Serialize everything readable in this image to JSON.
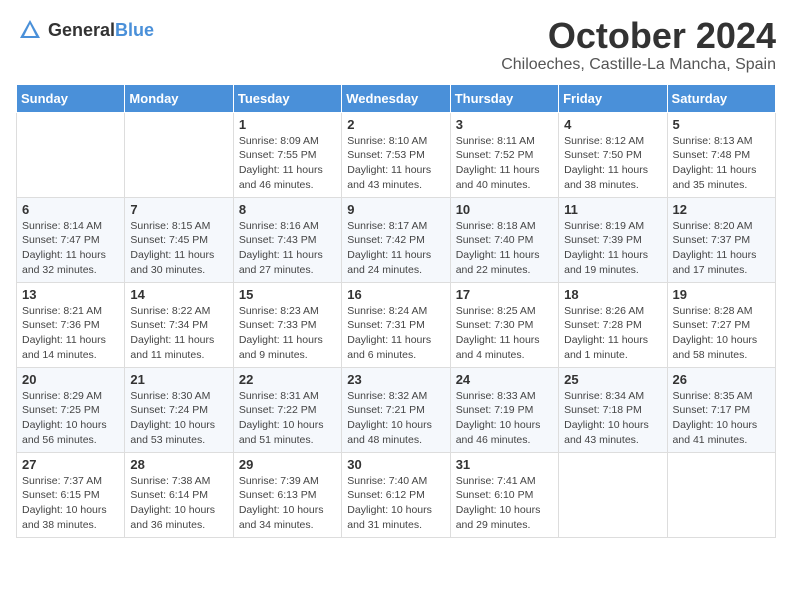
{
  "header": {
    "logo_general": "General",
    "logo_blue": "Blue",
    "month": "October 2024",
    "location": "Chiloeches, Castille-La Mancha, Spain"
  },
  "days_of_week": [
    "Sunday",
    "Monday",
    "Tuesday",
    "Wednesday",
    "Thursday",
    "Friday",
    "Saturday"
  ],
  "weeks": [
    [
      {
        "day": "",
        "info": ""
      },
      {
        "day": "",
        "info": ""
      },
      {
        "day": "1",
        "info": "Sunrise: 8:09 AM\nSunset: 7:55 PM\nDaylight: 11 hours and 46 minutes."
      },
      {
        "day": "2",
        "info": "Sunrise: 8:10 AM\nSunset: 7:53 PM\nDaylight: 11 hours and 43 minutes."
      },
      {
        "day": "3",
        "info": "Sunrise: 8:11 AM\nSunset: 7:52 PM\nDaylight: 11 hours and 40 minutes."
      },
      {
        "day": "4",
        "info": "Sunrise: 8:12 AM\nSunset: 7:50 PM\nDaylight: 11 hours and 38 minutes."
      },
      {
        "day": "5",
        "info": "Sunrise: 8:13 AM\nSunset: 7:48 PM\nDaylight: 11 hours and 35 minutes."
      }
    ],
    [
      {
        "day": "6",
        "info": "Sunrise: 8:14 AM\nSunset: 7:47 PM\nDaylight: 11 hours and 32 minutes."
      },
      {
        "day": "7",
        "info": "Sunrise: 8:15 AM\nSunset: 7:45 PM\nDaylight: 11 hours and 30 minutes."
      },
      {
        "day": "8",
        "info": "Sunrise: 8:16 AM\nSunset: 7:43 PM\nDaylight: 11 hours and 27 minutes."
      },
      {
        "day": "9",
        "info": "Sunrise: 8:17 AM\nSunset: 7:42 PM\nDaylight: 11 hours and 24 minutes."
      },
      {
        "day": "10",
        "info": "Sunrise: 8:18 AM\nSunset: 7:40 PM\nDaylight: 11 hours and 22 minutes."
      },
      {
        "day": "11",
        "info": "Sunrise: 8:19 AM\nSunset: 7:39 PM\nDaylight: 11 hours and 19 minutes."
      },
      {
        "day": "12",
        "info": "Sunrise: 8:20 AM\nSunset: 7:37 PM\nDaylight: 11 hours and 17 minutes."
      }
    ],
    [
      {
        "day": "13",
        "info": "Sunrise: 8:21 AM\nSunset: 7:36 PM\nDaylight: 11 hours and 14 minutes."
      },
      {
        "day": "14",
        "info": "Sunrise: 8:22 AM\nSunset: 7:34 PM\nDaylight: 11 hours and 11 minutes."
      },
      {
        "day": "15",
        "info": "Sunrise: 8:23 AM\nSunset: 7:33 PM\nDaylight: 11 hours and 9 minutes."
      },
      {
        "day": "16",
        "info": "Sunrise: 8:24 AM\nSunset: 7:31 PM\nDaylight: 11 hours and 6 minutes."
      },
      {
        "day": "17",
        "info": "Sunrise: 8:25 AM\nSunset: 7:30 PM\nDaylight: 11 hours and 4 minutes."
      },
      {
        "day": "18",
        "info": "Sunrise: 8:26 AM\nSunset: 7:28 PM\nDaylight: 11 hours and 1 minute."
      },
      {
        "day": "19",
        "info": "Sunrise: 8:28 AM\nSunset: 7:27 PM\nDaylight: 10 hours and 58 minutes."
      }
    ],
    [
      {
        "day": "20",
        "info": "Sunrise: 8:29 AM\nSunset: 7:25 PM\nDaylight: 10 hours and 56 minutes."
      },
      {
        "day": "21",
        "info": "Sunrise: 8:30 AM\nSunset: 7:24 PM\nDaylight: 10 hours and 53 minutes."
      },
      {
        "day": "22",
        "info": "Sunrise: 8:31 AM\nSunset: 7:22 PM\nDaylight: 10 hours and 51 minutes."
      },
      {
        "day": "23",
        "info": "Sunrise: 8:32 AM\nSunset: 7:21 PM\nDaylight: 10 hours and 48 minutes."
      },
      {
        "day": "24",
        "info": "Sunrise: 8:33 AM\nSunset: 7:19 PM\nDaylight: 10 hours and 46 minutes."
      },
      {
        "day": "25",
        "info": "Sunrise: 8:34 AM\nSunset: 7:18 PM\nDaylight: 10 hours and 43 minutes."
      },
      {
        "day": "26",
        "info": "Sunrise: 8:35 AM\nSunset: 7:17 PM\nDaylight: 10 hours and 41 minutes."
      }
    ],
    [
      {
        "day": "27",
        "info": "Sunrise: 7:37 AM\nSunset: 6:15 PM\nDaylight: 10 hours and 38 minutes."
      },
      {
        "day": "28",
        "info": "Sunrise: 7:38 AM\nSunset: 6:14 PM\nDaylight: 10 hours and 36 minutes."
      },
      {
        "day": "29",
        "info": "Sunrise: 7:39 AM\nSunset: 6:13 PM\nDaylight: 10 hours and 34 minutes."
      },
      {
        "day": "30",
        "info": "Sunrise: 7:40 AM\nSunset: 6:12 PM\nDaylight: 10 hours and 31 minutes."
      },
      {
        "day": "31",
        "info": "Sunrise: 7:41 AM\nSunset: 6:10 PM\nDaylight: 10 hours and 29 minutes."
      },
      {
        "day": "",
        "info": ""
      },
      {
        "day": "",
        "info": ""
      }
    ]
  ]
}
